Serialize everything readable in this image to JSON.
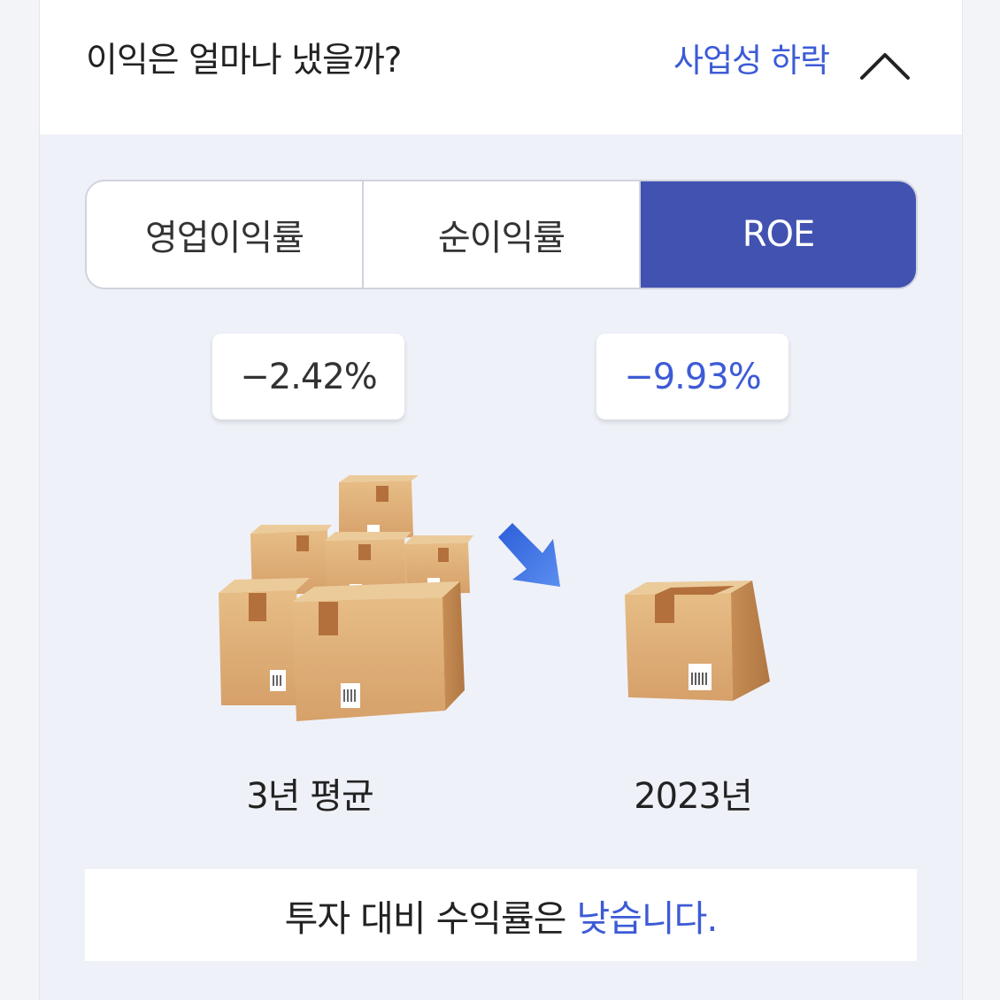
{
  "header": {
    "title": "이익은 얼마나 냈을까?",
    "status": "사업성 하락",
    "collapse_icon": "chevron-up-icon"
  },
  "tabs": [
    {
      "label": "영업이익률",
      "active": false
    },
    {
      "label": "순이익률",
      "active": false
    },
    {
      "label": "ROE",
      "active": true
    }
  ],
  "comparison": {
    "left": {
      "value": "−2.42%",
      "label": "3년 평균",
      "icon": "stacked-boxes-icon"
    },
    "right": {
      "value": "−9.93%",
      "label": "2023년",
      "icon": "single-box-icon"
    },
    "trend_icon": "down-arrow-icon"
  },
  "conclusion": {
    "text": "투자 대비 수익률은",
    "highlight": "낮습니다."
  },
  "colors": {
    "accent": "#3d5bd6",
    "active_tab": "#4252b0",
    "panel_bg": "#eff1f8"
  }
}
